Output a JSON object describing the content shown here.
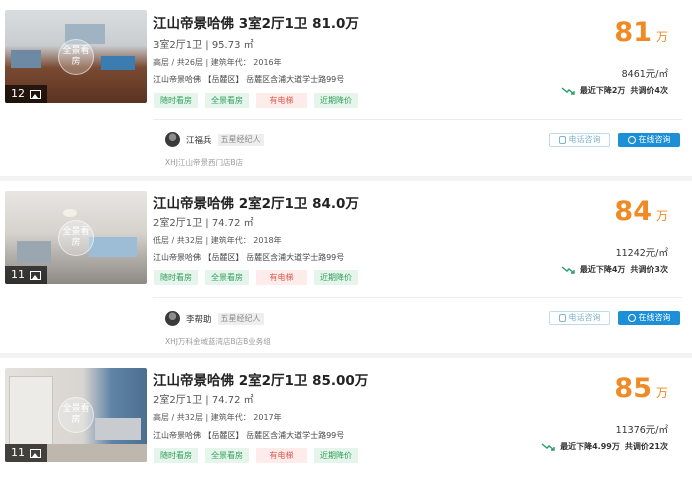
{
  "listings": [
    {
      "title": "江山帝景哈佛 3室2厅1卫 81.0万",
      "layout_area": "3室2厅1卫 | 95.73 ㎡",
      "floor_info": "高层 / 共26层 | 建筑年代： 2016年",
      "address": "江山帝景哈佛 【岳麓区】 岳麓区含浦大道学士路99号",
      "photo_label": "全景看房",
      "photo_count": "12",
      "tags": [
        "随时看房",
        "全景看房",
        "有电梯",
        "近期降价"
      ],
      "price": "81",
      "price_unit": "万",
      "unit_price": "8461元/㎡",
      "drop_text": "最近下降2万",
      "adjust_text": "共调价4次",
      "agent_name": "江福兵",
      "agent_badge": "五星经纪人",
      "store": "XHJ江山帝景西门店B店",
      "phone_btn": "电话咨询",
      "chat_btn": "在线咨询"
    },
    {
      "title": "江山帝景哈佛 2室2厅1卫 84.0万",
      "layout_area": "2室2厅1卫 | 74.72 ㎡",
      "floor_info": "低层 / 共32层 | 建筑年代： 2018年",
      "address": "江山帝景哈佛 【岳麓区】 岳麓区含浦大道学士路99号",
      "photo_label": "全景看房",
      "photo_count": "11",
      "tags": [
        "随时看房",
        "全景看房",
        "有电梯",
        "近期降价"
      ],
      "price": "84",
      "price_unit": "万",
      "unit_price": "11242元/㎡",
      "drop_text": "最近下降4万",
      "adjust_text": "共调价3次",
      "agent_name": "李帮助",
      "agent_badge": "五星经纪人",
      "store": "XHJ万科金域蓝湾店B店B业务组",
      "phone_btn": "电话咨询",
      "chat_btn": "在线咨询"
    },
    {
      "title": "江山帝景哈佛 2室2厅1卫 85.00万",
      "layout_area": "2室2厅1卫 | 74.72 ㎡",
      "floor_info": "高层 / 共32层 | 建筑年代： 2017年",
      "address": "江山帝景哈佛 【岳麓区】 岳麓区含浦大道学士路99号",
      "photo_label": "全景看房",
      "photo_count": "11",
      "tags": [
        "随时看房",
        "全景看房",
        "有电梯",
        "近期降价"
      ],
      "price": "85",
      "price_unit": "万",
      "unit_price": "11376元/㎡",
      "drop_text": "最近下降4.99万",
      "adjust_text": "共调价21次"
    }
  ],
  "colors": {
    "price": "#f08a24",
    "tag_green": "#2f9e58",
    "tag_red": "#e15a4f",
    "chat_button": "#1d8fd6",
    "drop_arrow": "#2a9d6a"
  }
}
